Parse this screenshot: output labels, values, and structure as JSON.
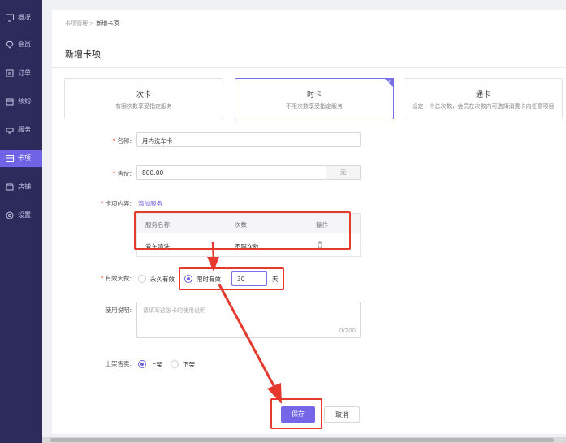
{
  "sidebar": {
    "items": [
      {
        "label": "概况",
        "icon": "monitor-icon"
      },
      {
        "label": "会员",
        "icon": "diamond-icon"
      },
      {
        "label": "订单",
        "icon": "list-icon"
      },
      {
        "label": "预约",
        "icon": "calendar-icon"
      },
      {
        "label": "服务",
        "icon": "service-icon"
      },
      {
        "label": "卡项",
        "icon": "card-icon",
        "active": true
      },
      {
        "label": "店铺",
        "icon": "shop-icon"
      },
      {
        "label": "设置",
        "icon": "settings-icon"
      }
    ]
  },
  "breadcrumb": {
    "parent": "卡项管理",
    "separator": ">",
    "current": "新增卡项"
  },
  "page_title": "新增卡项",
  "card_types": [
    {
      "title": "次卡",
      "desc": "有限次数享受指定服务"
    },
    {
      "title": "时卡",
      "desc": "不限次数享受指定服务",
      "selected": true
    },
    {
      "title": "通卡",
      "desc": "设定一个总次数，会员在次数内可选择消费卡内任意项目"
    }
  ],
  "form": {
    "name": {
      "label": "名称:",
      "value": "月内洗车卡"
    },
    "price": {
      "label": "售价:",
      "value": "800.00",
      "unit": "元"
    },
    "content": {
      "label": "卡项内容:",
      "add_link": "添加服务",
      "headers": [
        "服务名称",
        "次数",
        "操作"
      ],
      "rows": [
        {
          "name": "爱车清洗",
          "count": "不限次数",
          "action_icon": "trash-icon"
        }
      ]
    },
    "validity": {
      "label": "有效天数:",
      "option_forever": "永久有效",
      "option_limited": "限时有效",
      "days_value": "30",
      "days_unit": "天",
      "selected": "limited"
    },
    "usage": {
      "label": "使用说明:",
      "placeholder": "请填写这张卡的使用说明",
      "counter": "0/200"
    },
    "shelf": {
      "label": "上架售卖:",
      "option_on": "上架",
      "option_off": "下架",
      "selected": "on"
    }
  },
  "actions": {
    "save": "保存",
    "cancel": "取消"
  },
  "colors": {
    "sidebar_bg": "#2d2b5c",
    "accent": "#6f63e6",
    "annotation_red": "#e63a2e"
  }
}
